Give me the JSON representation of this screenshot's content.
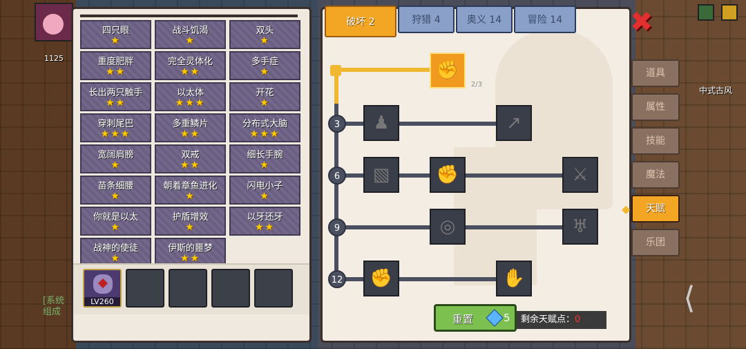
{
  "hud": {
    "coins": "1125",
    "system_text": "[系统\n组成",
    "map_label": "中式古风"
  },
  "talent_list": [
    {
      "name": "四只眼",
      "stars": "★"
    },
    {
      "name": "战斗饥渴",
      "stars": "★"
    },
    {
      "name": "双头",
      "stars": "★"
    },
    {
      "name": "重度肥胖",
      "stars": "★★"
    },
    {
      "name": "完全灵体化",
      "stars": "★★"
    },
    {
      "name": "多手症",
      "stars": "★"
    },
    {
      "name": "长出两只触手",
      "stars": "★★"
    },
    {
      "name": "以太体",
      "stars": "★★★"
    },
    {
      "name": "开花",
      "stars": "★"
    },
    {
      "name": "穿刺尾巴",
      "stars": "★★★"
    },
    {
      "name": "多重鳞片",
      "stars": "★★"
    },
    {
      "name": "分布式大脑",
      "stars": "★★★"
    },
    {
      "name": "宽阔肩膀",
      "stars": "★"
    },
    {
      "name": "双戒",
      "stars": "★★"
    },
    {
      "name": "细长手腕",
      "stars": "★"
    },
    {
      "name": "苗条细腰",
      "stars": "★"
    },
    {
      "name": "朝着章鱼进化",
      "stars": "★"
    },
    {
      "name": "闪电小子",
      "stars": "★"
    },
    {
      "name": "你就是以太",
      "stars": "★"
    },
    {
      "name": "护盾增效",
      "stars": "★"
    },
    {
      "name": "以牙还牙",
      "stars": "★★"
    },
    {
      "name": "战神的使徒",
      "stars": "★"
    },
    {
      "name": "伊斯的噩梦",
      "stars": "★★"
    }
  ],
  "slots": {
    "level_label": "LV260"
  },
  "tabs": [
    {
      "label": "破坏 2",
      "active": true
    },
    {
      "label": "狩猎 4",
      "active": false
    },
    {
      "label": "奥义 14",
      "active": false
    },
    {
      "label": "冒险 14",
      "active": false
    }
  ],
  "tree": {
    "levels": [
      "3",
      "6",
      "9",
      "12"
    ],
    "top_node_count": "2/3",
    "icons": {
      "top": "arm-wrestle-icon",
      "r3a": "torso-icon",
      "r3b": "arrow-icon",
      "r6a": "cards-icon",
      "r6b": "punch-icon",
      "r6c": "slash-icon",
      "r9a": "ripple-icon",
      "r9b": "bat-icon",
      "r12a": "fist-icon",
      "r12b": "grab-icon"
    }
  },
  "reset": {
    "label": "重置",
    "cost": "5"
  },
  "remaining": {
    "label": "剩余天赋点：",
    "value": "0"
  },
  "side_menu": [
    {
      "label": "道具",
      "active": false
    },
    {
      "label": "属性",
      "active": false
    },
    {
      "label": "技能",
      "active": false
    },
    {
      "label": "魔法",
      "active": false
    },
    {
      "label": "天赋",
      "active": true
    },
    {
      "label": "乐团",
      "active": false
    }
  ]
}
